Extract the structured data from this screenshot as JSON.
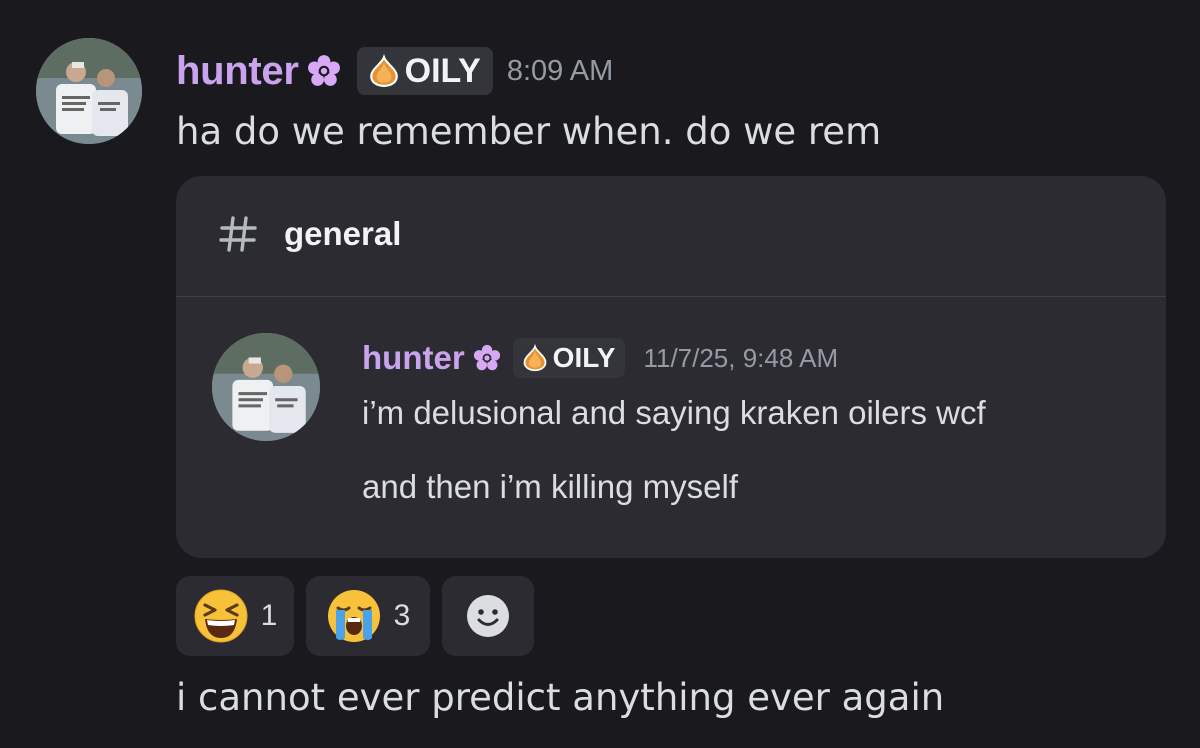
{
  "main_message": {
    "username": "hunter",
    "tag": "OILY",
    "timestamp": "8:09 AM",
    "text": "ha do we remember when. do we rem"
  },
  "forwarded": {
    "channel_name": "general",
    "message": {
      "username": "hunter",
      "tag": "OILY",
      "timestamp": "11/7/25, 9:48 AM",
      "text_line1": "i’m delusional and saying kraken oilers wcf",
      "text_line2": "and then i’m killing myself"
    }
  },
  "reactions": [
    {
      "icon": "grinning-squinting-face-icon",
      "count": "1"
    },
    {
      "icon": "loudly-crying-face-icon",
      "count": "3"
    },
    {
      "icon": "add-reaction-icon"
    }
  ],
  "followup_message": {
    "text": "i cannot ever predict anything ever again"
  },
  "colors": {
    "background": "#1a1a1e",
    "embed_background": "#2b2b31",
    "username": "#c9a3ee",
    "timestamp": "#949ba4",
    "text": "#dbdee1"
  },
  "icons": {
    "flower": "flower-icon",
    "tag": "onion-tag-icon",
    "channel": "hash-icon"
  }
}
